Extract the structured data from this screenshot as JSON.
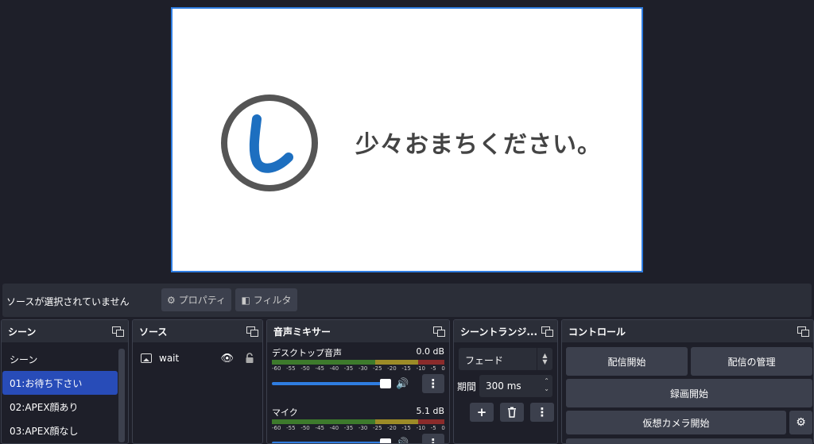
{
  "preview": {
    "logo_icon": "shiori-logo-icon",
    "wait_text": "少々おまちください。",
    "colors": {
      "canvas_border": "#2f7de1",
      "logo_ring": "#555555",
      "logo_mark": "#1d6fc0",
      "text": "#444444"
    }
  },
  "context_bar": {
    "no_source_text": "ソースが選択されていません",
    "properties_label": "プロパティ",
    "filters_label": "フィルタ"
  },
  "scenes": {
    "title": "シーン",
    "items": [
      {
        "label": "シーン"
      },
      {
        "label": "01:お待ち下さい"
      },
      {
        "label": "02:APEX顔あり"
      },
      {
        "label": "03:APEX顔なし"
      }
    ],
    "selected_index": 1
  },
  "sources": {
    "title": "ソース",
    "items": [
      {
        "label": "wait",
        "icon": "image-icon",
        "visible": true,
        "locked": false
      }
    ]
  },
  "mixer": {
    "title": "音声ミキサー",
    "channels": [
      {
        "name": "デスクトップ音声",
        "level": "0.0 dB",
        "fader": 0.94
      },
      {
        "name": "マイク",
        "level": "5.1 dB",
        "fader": 0.94
      }
    ],
    "ticks": [
      "-60",
      "-55",
      "-50",
      "-45",
      "-40",
      "-35",
      "-30",
      "-25",
      "-20",
      "-15",
      "-10",
      "-5",
      "0"
    ]
  },
  "transitions": {
    "title": "シーントランジ...",
    "selected": "フェード",
    "duration_label": "期間",
    "duration_value": "300 ms"
  },
  "controls": {
    "title": "コントロール",
    "start_streaming": "配信開始",
    "manage_broadcast": "配信の管理",
    "start_recording": "録画開始",
    "start_virtual_camera": "仮想カメラ開始"
  }
}
